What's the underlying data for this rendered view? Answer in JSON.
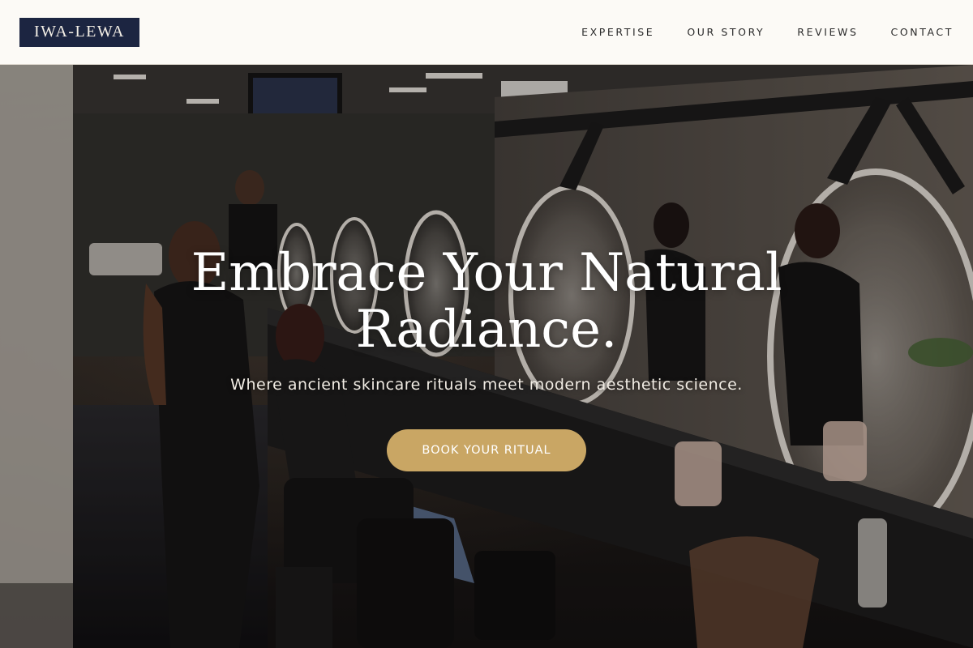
{
  "brand": {
    "logo_text": "IWA-LEWA"
  },
  "nav": {
    "items": [
      {
        "label": "EXPERTISE"
      },
      {
        "label": "OUR STORY"
      },
      {
        "label": "REVIEWS"
      },
      {
        "label": "CONTACT"
      }
    ]
  },
  "hero": {
    "headline": "Embrace Your Natural Radiance.",
    "subheadline": "Where ancient skincare rituals meet modern aesthetic science.",
    "cta_label": "BOOK YOUR RITUAL",
    "background_image": "salon-interior-photo"
  },
  "colors": {
    "header_bg": "#fcfaf6",
    "logo_bg": "#1c2541",
    "cta_bg": "#c9a664"
  }
}
